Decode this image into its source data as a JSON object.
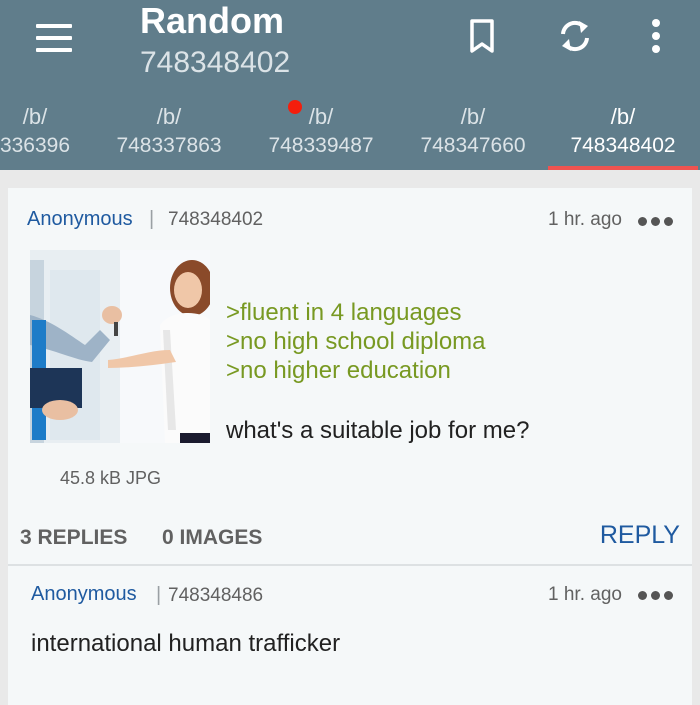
{
  "app_bar": {
    "title": "Random",
    "subtitle": "748348402",
    "icons": [
      "menu-icon",
      "bookmark-icon",
      "refresh-icon",
      "more-vertical-icon"
    ]
  },
  "tabs": [
    {
      "board": "/b/",
      "thread": "336396",
      "active": false,
      "unread": false
    },
    {
      "board": "/b/",
      "thread": "748337863",
      "active": false,
      "unread": false
    },
    {
      "board": "/b/",
      "thread": "748339487",
      "active": false,
      "unread": true
    },
    {
      "board": "/b/",
      "thread": "748347660",
      "active": false,
      "unread": false
    },
    {
      "board": "/b/",
      "thread": "748348402",
      "active": true,
      "unread": false
    }
  ],
  "op_post": {
    "author": "Anonymous",
    "separator": "|",
    "post_number": "748348402",
    "time": "1 hr. ago",
    "greentext": [
      ">fluent in 4 languages",
      ">no high school diploma",
      ">no higher education"
    ],
    "body": "what's a suitable job for me?",
    "file_info": "45.8 kB JPG"
  },
  "thread_stats": {
    "replies": "3 REPLIES",
    "images": "0 IMAGES",
    "reply_button": "REPLY"
  },
  "reply_post": {
    "author": "Anonymous",
    "separator": "|",
    "post_number": "748348486",
    "time": "1 hr. ago",
    "body": "international human trafficker"
  },
  "colors": {
    "app_bar": "#607d8b",
    "tab_indicator": "#ef5350",
    "unread_dot": "#f41e0c",
    "name": "#1f5aa0",
    "greentext": "#789922"
  }
}
